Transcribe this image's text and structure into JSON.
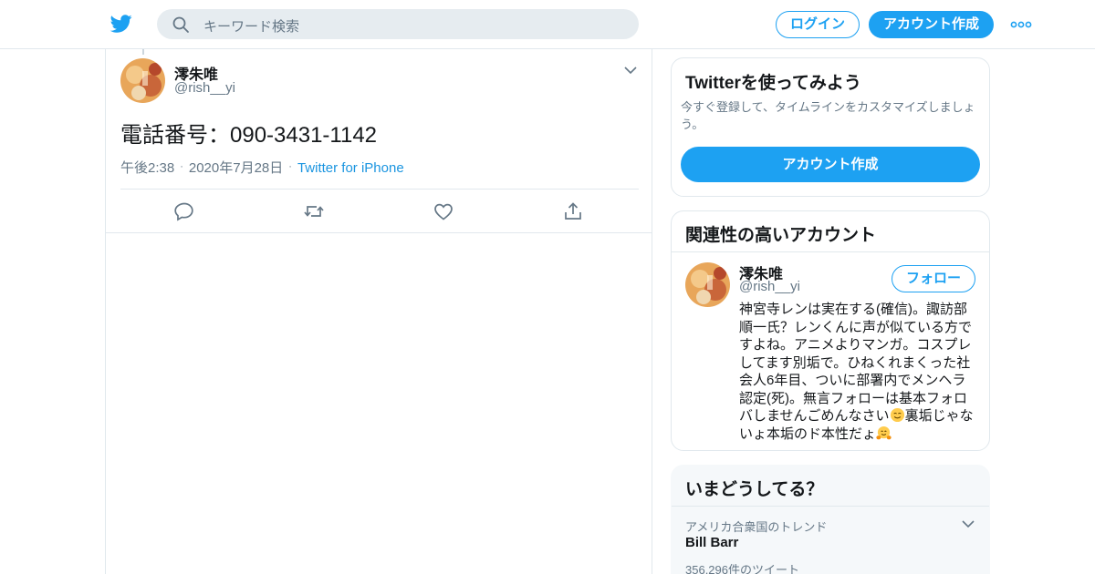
{
  "header": {
    "search_placeholder": "キーワード検索",
    "login_label": "ログイン",
    "signup_label": "アカウント作成"
  },
  "tweet": {
    "display_name": "澪朱唯",
    "handle": "@rish__yi",
    "text": "電話番号：090-3431-1142",
    "time": "午後2:38",
    "date": "2020年7月28日",
    "source": "Twitter for iPhone"
  },
  "try_card": {
    "title": "Twitterを使ってみよう",
    "description": "今すぐ登録して、タイムラインをカスタマイズしましょう。",
    "button_label": "アカウント作成"
  },
  "related": {
    "title": "関連性の高いアカウント",
    "account": {
      "display_name": "澪朱唯",
      "handle": "@rish__yi",
      "follow_label": "フォロー",
      "bio_part1": "神宮寺レンは実在する(確信)。諏訪部順一氏？レンくんに声が似ている方ですよね。アニメよりマンガ。コスプレしてます別垢で。ひねくれまくった社会人6年目、ついに部署内でメンヘラ認定(死)。無言フォローは基本フォロバしませんごめんなさい",
      "bio_part2": "裏垢じゃないょ本垢のド本性だょ"
    }
  },
  "trends": {
    "title": "いまどうしてる？",
    "items": [
      {
        "context": "アメリカ合衆国のトレンド",
        "name": "Bill Barr",
        "count": "356,296件のツイート"
      }
    ]
  },
  "colors": {
    "accent": "#1da1f2",
    "link": "#1b95e0",
    "secondary_text": "#657786",
    "border": "#e1e8ed"
  }
}
